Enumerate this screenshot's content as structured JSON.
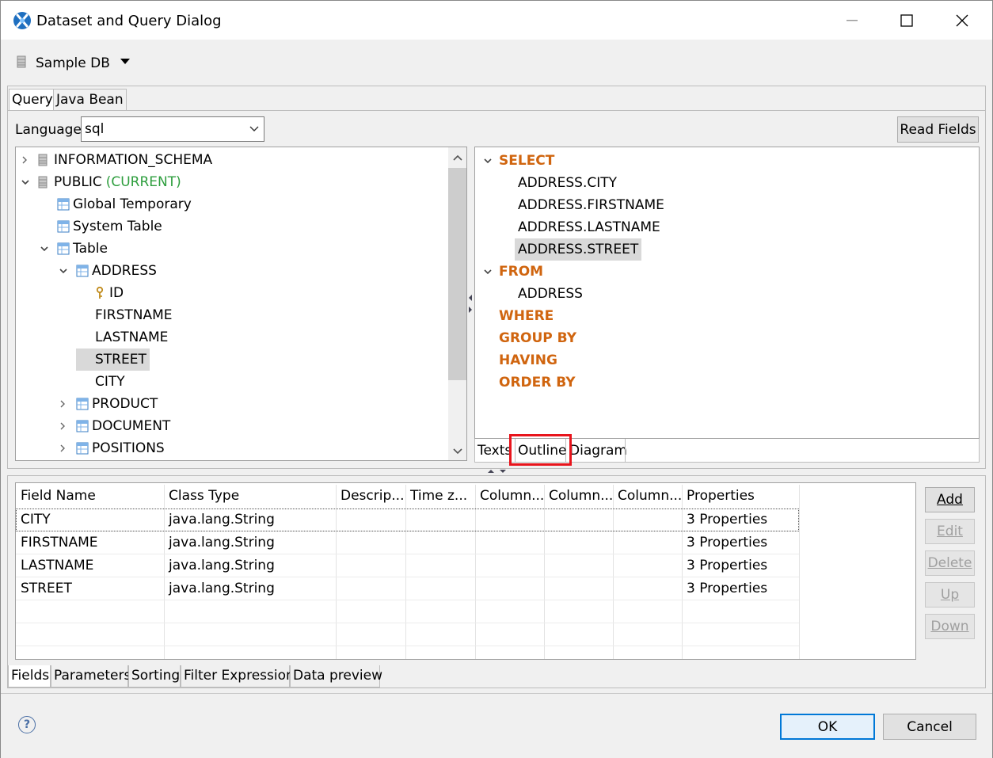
{
  "window": {
    "title": "Dataset and Query Dialog",
    "minimize": "—",
    "maximize": "□",
    "close": "✕"
  },
  "datasource": {
    "name": "Sample DB",
    "icon": "database-icon"
  },
  "top_tabs": [
    {
      "label": "Query",
      "active": true
    },
    {
      "label": "Java Bean",
      "active": false
    }
  ],
  "language": {
    "label": "Language",
    "value": "sql"
  },
  "read_fields_label": "Read Fields",
  "tree": [
    {
      "label": "INFORMATION_SCHEMA",
      "suffix": "",
      "icon": "schema-icon",
      "twisty": "collapsed"
    },
    {
      "label": "PUBLIC",
      "suffix": "(CURRENT)",
      "icon": "schema-icon",
      "twisty": "expanded"
    },
    {
      "label": "Global Temporary",
      "suffix": "",
      "icon": "table-icon",
      "twisty": "none"
    },
    {
      "label": "System Table",
      "suffix": "",
      "icon": "table-icon",
      "twisty": "none"
    },
    {
      "label": "Table",
      "suffix": "",
      "icon": "table-icon",
      "twisty": "expanded"
    },
    {
      "label": "ADDRESS",
      "suffix": "",
      "icon": "table-icon",
      "twisty": "expanded"
    },
    {
      "label": "ID",
      "suffix": "",
      "icon": "key-icon",
      "twisty": "none"
    },
    {
      "label": "FIRSTNAME",
      "suffix": "",
      "icon": "",
      "twisty": "none"
    },
    {
      "label": "LASTNAME",
      "suffix": "",
      "icon": "",
      "twisty": "none"
    },
    {
      "label": "STREET",
      "suffix": "",
      "icon": "",
      "twisty": "none",
      "selected": true
    },
    {
      "label": "CITY",
      "suffix": "",
      "icon": "",
      "twisty": "none"
    },
    {
      "label": "PRODUCT",
      "suffix": "",
      "icon": "table-icon",
      "twisty": "collapsed"
    },
    {
      "label": "DOCUMENT",
      "suffix": "",
      "icon": "table-icon",
      "twisty": "collapsed"
    },
    {
      "label": "POSITIONS",
      "suffix": "",
      "icon": "table-icon",
      "twisty": "collapsed"
    }
  ],
  "outline": [
    {
      "label": "SELECT",
      "keyword": true,
      "twisty": "expanded"
    },
    {
      "label": "ADDRESS.CITY",
      "keyword": false
    },
    {
      "label": "ADDRESS.FIRSTNAME",
      "keyword": false
    },
    {
      "label": "ADDRESS.LASTNAME",
      "keyword": false
    },
    {
      "label": "ADDRESS.STREET",
      "keyword": false,
      "selected": true
    },
    {
      "label": "FROM",
      "keyword": true,
      "twisty": "expanded"
    },
    {
      "label": "ADDRESS",
      "keyword": false
    },
    {
      "label": "WHERE",
      "keyword": true
    },
    {
      "label": "GROUP BY",
      "keyword": true
    },
    {
      "label": "HAVING",
      "keyword": true
    },
    {
      "label": "ORDER BY",
      "keyword": true
    }
  ],
  "view_tabs": [
    {
      "label": "Texts",
      "active": false
    },
    {
      "label": "Outline",
      "active": true
    },
    {
      "label": "Diagram",
      "active": false
    }
  ],
  "highlight_color": "#e8141c",
  "fields_table": {
    "columns": [
      "Field Name",
      "Class Type",
      "Descrip...",
      "Time z...",
      "Column...",
      "Column...",
      "Column...",
      "Properties"
    ],
    "rows": [
      [
        "CITY",
        "java.lang.String",
        "",
        "",
        "",
        "",
        "",
        "3 Properties"
      ],
      [
        "FIRSTNAME",
        "java.lang.String",
        "",
        "",
        "",
        "",
        "",
        "3 Properties"
      ],
      [
        "LASTNAME",
        "java.lang.String",
        "",
        "",
        "",
        "",
        "",
        "3 Properties"
      ],
      [
        "STREET",
        "java.lang.String",
        "",
        "",
        "",
        "",
        "",
        "3 Properties"
      ]
    ]
  },
  "side_buttons": [
    {
      "label": "Add",
      "enabled": true
    },
    {
      "label": "Edit",
      "enabled": false
    },
    {
      "label": "Delete",
      "enabled": false
    },
    {
      "label": "Up",
      "enabled": false
    },
    {
      "label": "Down",
      "enabled": false
    }
  ],
  "bottom_tabs": [
    {
      "label": "Fields",
      "active": true
    },
    {
      "label": "Parameters",
      "active": false
    },
    {
      "label": "Sorting",
      "active": false
    },
    {
      "label": "Filter Expression",
      "active": false
    },
    {
      "label": "Data preview",
      "active": false
    }
  ],
  "footer": {
    "help": "?",
    "ok": "OK",
    "cancel": "Cancel"
  }
}
